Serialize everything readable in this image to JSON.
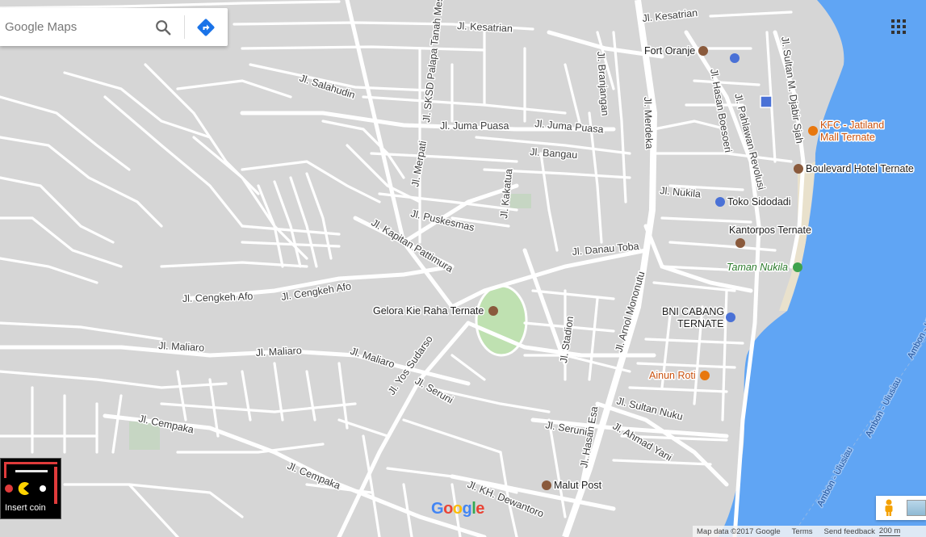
{
  "search": {
    "placeholder": "Google Maps"
  },
  "icons": {
    "search": "search-icon",
    "directions": "directions-icon",
    "apps": "apps-grid-icon",
    "pegman": "pegman-icon"
  },
  "colors": {
    "water": "#60a5f4",
    "road": "#ffffff",
    "land": "#d6d6d6",
    "park": "#b5e0a8",
    "beach": "#eae3cf",
    "poi_food": "#e8770e",
    "poi_transit": "#4a71d6"
  },
  "streets": [
    {
      "name": "Jl. Kesatrian"
    },
    {
      "name": "Jl. Kesatrian"
    },
    {
      "name": "Jl. SKSD Palapa Tanah Mes"
    },
    {
      "name": "Jl. Salahudin"
    },
    {
      "name": "Jl. Juma Puasa"
    },
    {
      "name": "Jl. Juma Puasa"
    },
    {
      "name": "Jl. Branjangan"
    },
    {
      "name": "Jl. Merdeka"
    },
    {
      "name": "Jl. Hasan Boesoeri"
    },
    {
      "name": "Jl. Pahlawan Revolusi"
    },
    {
      "name": "Jl. Sultan M. Djabir Sjah"
    },
    {
      "name": "Jl. Bangau"
    },
    {
      "name": "Jl. Merpati"
    },
    {
      "name": "Jl. Nukila"
    },
    {
      "name": "Jl. Kakatua"
    },
    {
      "name": "Jl. Puskesmas"
    },
    {
      "name": "Jl. Kapitan Pattimura"
    },
    {
      "name": "Jl. Danau Toba"
    },
    {
      "name": "Jl. Arnol Mononutu"
    },
    {
      "name": "Jl. Cengkeh Afo"
    },
    {
      "name": "Jl. Cengkeh Afo"
    },
    {
      "name": "Jl. Maliaro"
    },
    {
      "name": "Jl. Maliaro"
    },
    {
      "name": "Jl. Maliaro"
    },
    {
      "name": "Jl. Yos Sudarso"
    },
    {
      "name": "Jl. Seruni"
    },
    {
      "name": "Jl. Stadion"
    },
    {
      "name": "Jl. Sultan Nuku"
    },
    {
      "name": "Jl. Cempaka"
    },
    {
      "name": "Jl. Seruni"
    },
    {
      "name": "Jl. Hasan Esa"
    },
    {
      "name": "Jl. Ahmad Yani"
    },
    {
      "name": "Jl. Cempaka"
    },
    {
      "name": "Jl. KH. Dewantoro"
    },
    {
      "name": "Ambon - Ulusiau"
    },
    {
      "name": "Ambon - Ulusiau"
    },
    {
      "name": "Ambon - Ulusiau"
    }
  ],
  "pois": [
    {
      "name": "Fort Oranje",
      "icon": "landmark-icon"
    },
    {
      "name": "KFC - Jatiland",
      "name2": "Mall Ternate",
      "icon": "restaurant-icon"
    },
    {
      "name": "Boulevard Hotel Ternate",
      "icon": "hotel-icon"
    },
    {
      "name": "Toko Sidodadi",
      "icon": "shopping-icon"
    },
    {
      "name": "Kantorpos Ternate",
      "icon": "post-office-icon"
    },
    {
      "name": "Taman Nukila",
      "icon": "park-icon"
    },
    {
      "name": "BNI CABANG",
      "name2": "TERNATE",
      "icon": "bank-icon"
    },
    {
      "name": "Gelora Kie Raha Ternate",
      "icon": "stadium-icon"
    },
    {
      "name": "Ainun Roti",
      "icon": "restaurant-icon"
    },
    {
      "name": "Malut Post",
      "icon": "post-office-icon"
    }
  ],
  "pacman": {
    "label": "Insert coin"
  },
  "logo": {
    "letters": [
      "G",
      "o",
      "o",
      "g",
      "l",
      "e"
    ],
    "colors": [
      "#4285f4",
      "#ea4335",
      "#fbbc05",
      "#4285f4",
      "#34a853",
      "#ea4335"
    ]
  },
  "footer": {
    "map_data": "Map data ©2017 Google",
    "terms": "Terms",
    "feedback": "Send feedback",
    "scale": "200 m"
  }
}
